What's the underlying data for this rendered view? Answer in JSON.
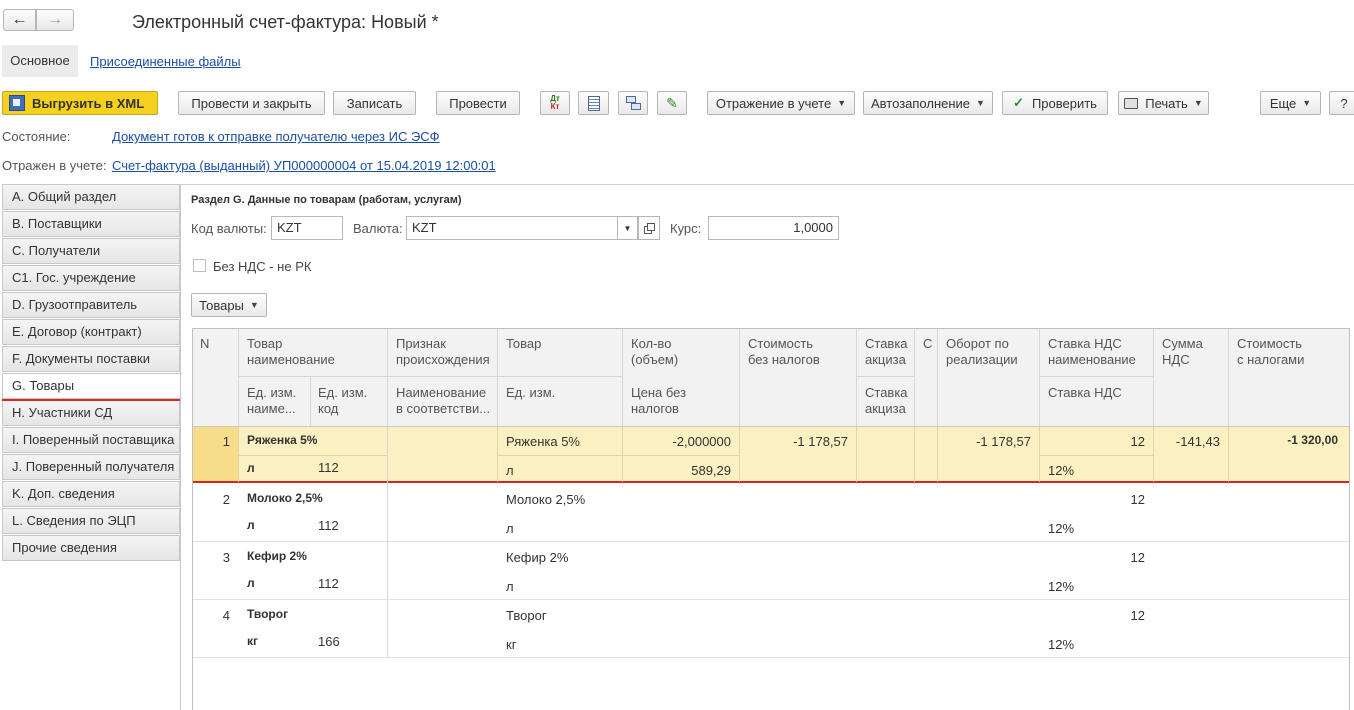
{
  "window": {
    "title": "Электронный счет-фактура: Новый *"
  },
  "nav_tabs": {
    "main": "Основное",
    "attached": "Присоединенные файлы"
  },
  "toolbar": {
    "export_xml": "Выгрузить в XML",
    "post_close": "Провести и закрыть",
    "save": "Записать",
    "post": "Провести",
    "accounting": "Отражение в учете",
    "autofill": "Автозаполнение",
    "check": "Проверить",
    "print": "Печать",
    "more": "Еще",
    "help": "?"
  },
  "status": {
    "state_label": "Состояние:",
    "state_value": "Документ готов к отправке получателю через ИС ЭСФ",
    "reflected_label": "Отражен в учете:",
    "reflected_value": "Счет-фактура (выданный) УП000000004 от 15.04.2019 12:00:01"
  },
  "sections": [
    "А. Общий раздел",
    "В. Поставщики",
    "С. Получатели",
    "С1. Гос. учреждение",
    "D. Грузоотправитель",
    "Е. Договор (контракт)",
    "F. Документы поставки",
    "G. Товары",
    "H. Участники СД",
    "I. Поверенный поставщика",
    "J. Поверенный получателя",
    "K. Доп. сведения",
    "L. Сведения по ЭЦП",
    "Прочие сведения"
  ],
  "panel": {
    "title": "Раздел G. Данные по товарам (работам, услугам)",
    "currency_code_label": "Код валюты:",
    "currency_code": "KZT",
    "currency_label": "Валюта:",
    "currency": "KZT",
    "rate_label": "Курс:",
    "rate": "1,0000",
    "no_vat_label": "Без НДС - не РК",
    "goods_button": "Товары"
  },
  "table": {
    "headers": {
      "n": "N",
      "goods_name_1": "Товар",
      "goods_name_2": "наименование",
      "unit_name_1": "Ед. изм.",
      "unit_name_2": "наиме...",
      "unit_code_1": "Ед. изм.",
      "unit_code_2": "код",
      "origin_1": "Признак",
      "origin_2": "происхождения",
      "origin_sub_1": "Наименование",
      "origin_sub_2": "в соответстви...",
      "goods": "Товар",
      "goods_unit": "Ед. изм.",
      "qty_1": "Кол-во",
      "qty_2": "(объем)",
      "price_1": "Цена без",
      "price_2": "налогов",
      "cost_1": "Стоимость",
      "cost_2": "без налогов",
      "excise_1": "Ставка",
      "excise_2": "акциза",
      "excise_sub_1": "Ставка",
      "excise_sub_2": "акциза",
      "narrow": "С",
      "turnover_1": "Оборот по",
      "turnover_2": "реализации",
      "vat_rate_1": "Ставка НДС",
      "vat_rate_2": "наименование",
      "vat_rate_sub": "Ставка НДС",
      "vat_sum_1": "Сумма",
      "vat_sum_2": "НДС",
      "total_1": "Стоимость",
      "total_2": "с налогами"
    },
    "rows": [
      {
        "n": "1",
        "name": "Ряженка 5%",
        "unit": "л",
        "code": "112",
        "goods": "Ряженка 5%",
        "goods_unit": "л",
        "qty": "-2,000000",
        "price": "589,29",
        "cost": "-1 178,57",
        "turnover": "-1 178,57",
        "vat_rate": "12",
        "vat_rate_name": "12%",
        "vat_sum": "-141,43",
        "total": "-1 320,00"
      },
      {
        "n": "2",
        "name": "Молоко 2,5%",
        "unit": "л",
        "code": "112",
        "goods": "Молоко 2,5%",
        "goods_unit": "л",
        "vat_rate": "12",
        "vat_rate_name": "12%"
      },
      {
        "n": "3",
        "name": "Кефир 2%",
        "unit": "л",
        "code": "112",
        "goods": "Кефир 2%",
        "goods_unit": "л",
        "vat_rate": "12",
        "vat_rate_name": "12%"
      },
      {
        "n": "4",
        "name": "Творог",
        "unit": "кг",
        "code": "166",
        "goods": "Творог",
        "goods_unit": "кг",
        "vat_rate": "12",
        "vat_rate_name": "12%"
      }
    ]
  },
  "colors": {
    "selected_row": "#fbf0c2",
    "selected_cell": "#f7dc8a",
    "accent_red": "#d9261c",
    "xml_button": "#f5d01f",
    "link": "#1a4fa0"
  },
  "icons": [
    "back-arrow-icon",
    "forward-arrow-icon",
    "xml-export-icon",
    "dt-kt-icon",
    "list-icon",
    "structure-icon",
    "edit-pencil-icon",
    "check-mark-icon",
    "printer-icon"
  ]
}
